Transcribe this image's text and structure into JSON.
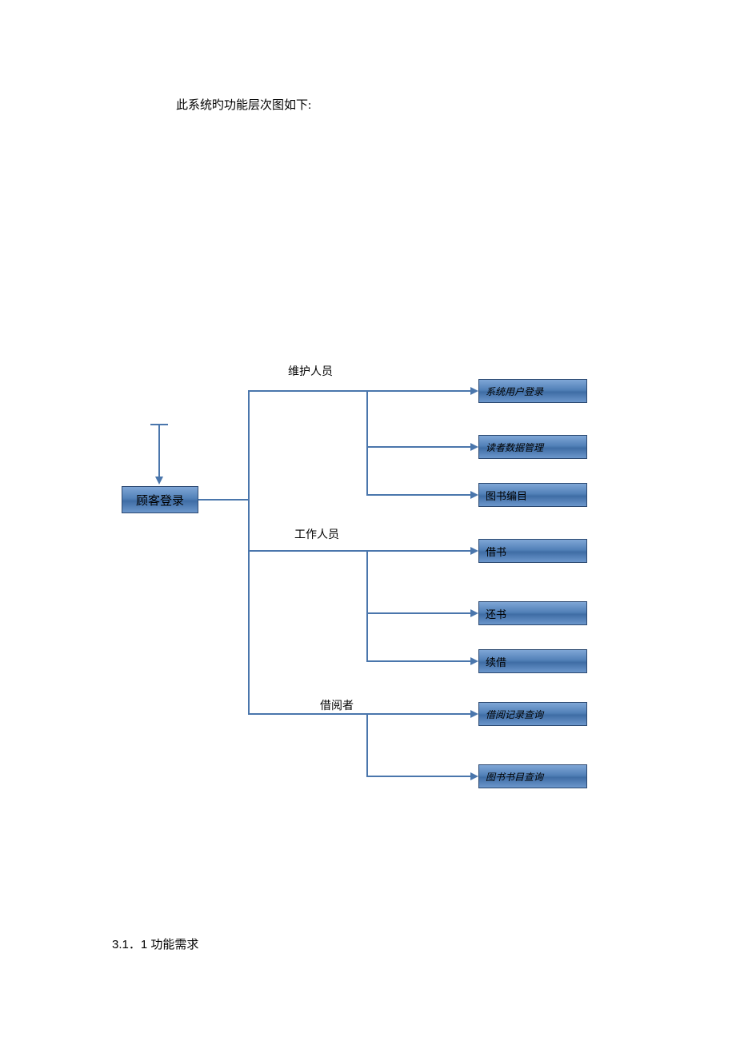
{
  "intro_text": "此系统旳功能层次图如下:",
  "section_heading": "3.1．1 功能需求",
  "roles": {
    "maintenance": "维护人员",
    "staff": "工作人员",
    "borrower": "借阅者"
  },
  "root_node": "顾客登录",
  "leaf_nodes": {
    "maint_1": "系统用户登录",
    "maint_2": "读者数据管理",
    "maint_3": "图书编目",
    "staff_1": "借书",
    "staff_2": "还书",
    "staff_3": "续借",
    "borrower_1": "借阅记录查询",
    "borrower_2": "图书书目查询"
  }
}
